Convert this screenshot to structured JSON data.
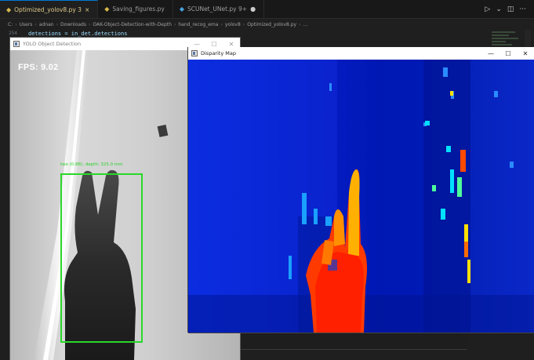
{
  "editor": {
    "tabs": [
      {
        "label": "Optimized_yolov8.py 3",
        "active": true,
        "icon": "python-file-icon"
      },
      {
        "label": "Saving_figures.py",
        "active": false,
        "icon": "python-file-icon"
      },
      {
        "label": "SCUNet_UNet.py 9+",
        "active": false,
        "icon": "python-file-icon",
        "modified": true
      }
    ],
    "breadcrumb": [
      "C:",
      "Users",
      "adnan",
      "Downloads",
      "OAK-Object-Detection-with-Depth",
      "hand_recog_ema",
      "yolov8",
      "Optimized_yolov8.py",
      "..."
    ],
    "code_line": {
      "number": "254",
      "text": "detections = in_det.detections"
    }
  },
  "yolo_window": {
    "title": "YOLO Object Detection",
    "fps": "FPS: 9.02",
    "detection_label": "two (0.88), depth: 325.0 mm"
  },
  "disparity_window": {
    "title": "Disparity Map"
  },
  "window_controls": {
    "minimize": "—",
    "maximize": "☐",
    "close": "✕"
  },
  "colors": {
    "detection_box": "#29d829",
    "disparity_far": "#0a24d6",
    "disparity_near": "#ff2a00"
  }
}
